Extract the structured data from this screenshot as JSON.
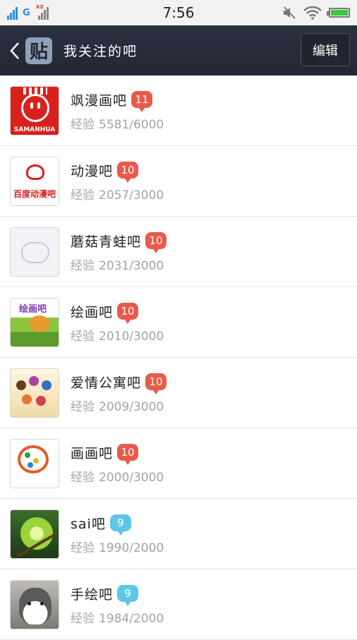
{
  "status_bar": {
    "time": "7:56",
    "network_1": "G",
    "network_2": "xz",
    "icons": [
      "signal-icon",
      "signal-icon-2",
      "mute-icon",
      "wifi-icon",
      "battery-icon"
    ]
  },
  "nav": {
    "logo_text": "贴",
    "title": "我关注的吧",
    "edit_label": "编辑"
  },
  "exp_label": "经验",
  "colors": {
    "nav_bg": "#232634",
    "badge_red": "#ea5a4a",
    "badge_blue": "#5fc6e8"
  },
  "forums": [
    {
      "name": "飒漫画吧",
      "level": "11",
      "level_color": "red",
      "exp": "5581/6000",
      "avatar": "samanhua-avatar",
      "avatar_text": "SAMANHUA"
    },
    {
      "name": "动漫吧",
      "level": "10",
      "level_color": "red",
      "exp": "2057/3000",
      "avatar": "dongman-avatar",
      "avatar_text": "百度动漫吧"
    },
    {
      "name": "蘑菇青蛙吧",
      "level": "10",
      "level_color": "red",
      "exp": "2031/3000",
      "avatar": "placeholder-avatar"
    },
    {
      "name": "绘画吧",
      "level": "10",
      "level_color": "red",
      "exp": "2010/3000",
      "avatar": "huihua-avatar",
      "avatar_text": "绘画吧"
    },
    {
      "name": "爱情公寓吧",
      "level": "10",
      "level_color": "red",
      "exp": "2009/3000",
      "avatar": "aiqing-avatar"
    },
    {
      "name": "画画吧",
      "level": "10",
      "level_color": "red",
      "exp": "2000/3000",
      "avatar": "huahua-avatar"
    },
    {
      "name": "sai吧",
      "level": "9",
      "level_color": "blue",
      "exp": "1990/2000",
      "avatar": "sai-avatar"
    },
    {
      "name": "手绘吧",
      "level": "9",
      "level_color": "blue",
      "exp": "1984/2000",
      "avatar": "shouhui-avatar"
    }
  ]
}
